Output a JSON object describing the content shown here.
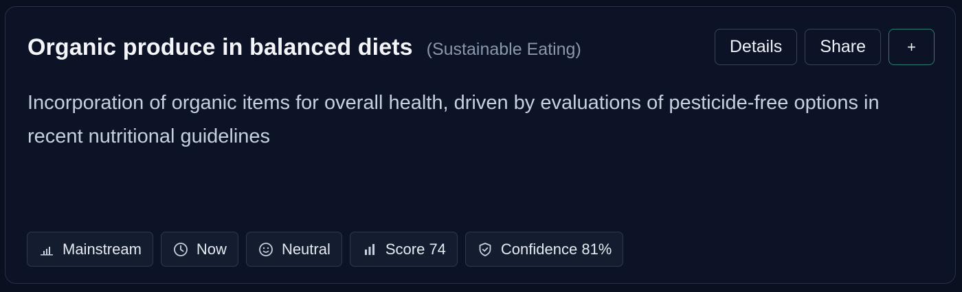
{
  "card": {
    "title": "Organic produce in balanced diets",
    "category": "(Sustainable Eating)",
    "description": "Incorporation of organic items for overall health, driven by evaluations of pesticide-free options in recent nutritional guidelines",
    "actions": {
      "details_label": "Details",
      "share_label": "Share",
      "add_label": "+"
    },
    "badges": [
      {
        "icon": "signal-bars-icon",
        "label": "Mainstream"
      },
      {
        "icon": "clock-icon",
        "label": "Now"
      },
      {
        "icon": "smiley-icon",
        "label": "Neutral"
      },
      {
        "icon": "bar-chart-icon",
        "label": "Score 74"
      },
      {
        "icon": "shield-check-icon",
        "label": "Confidence 81%"
      }
    ]
  },
  "colors": {
    "background": "#0b1020",
    "card": "#0c1326",
    "border": "#27314a",
    "accent": "#2f7d72",
    "muted_text": "#8a97ad"
  }
}
